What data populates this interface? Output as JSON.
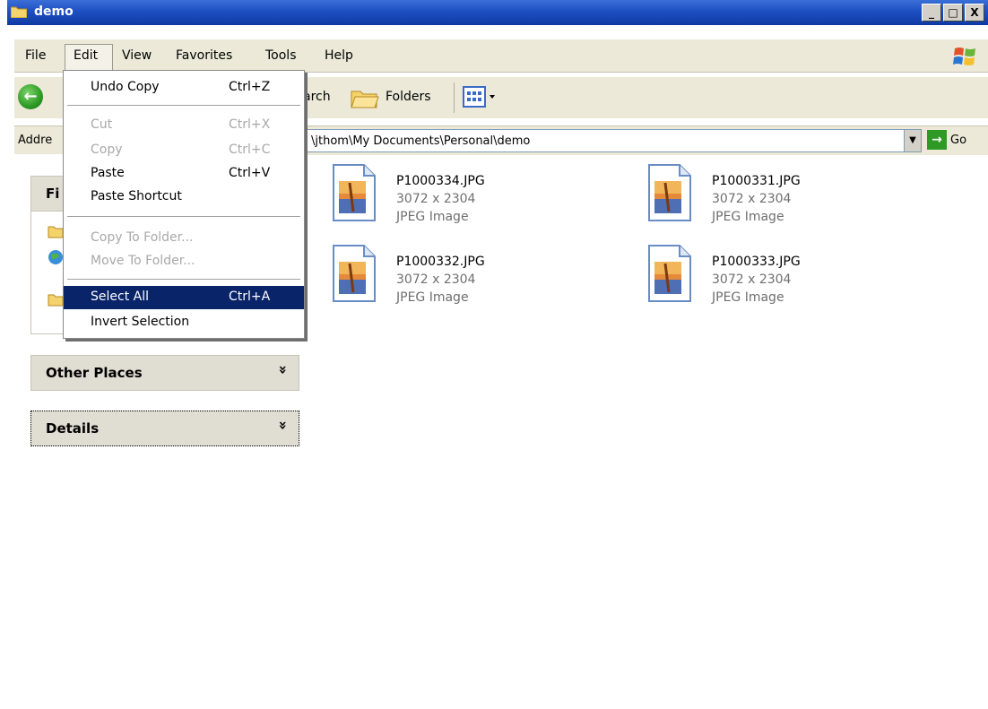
{
  "window": {
    "title": "demo"
  },
  "window_controls": [
    "_",
    "□",
    "X"
  ],
  "menubar": {
    "items": [
      "File",
      "Edit",
      "View",
      "Favorites",
      "Tools",
      "Help"
    ]
  },
  "toolbar": {
    "search_partial": "arch",
    "folders": "Folders"
  },
  "address": {
    "label": "Addre",
    "path": "\\jthom\\My Documents\\Personal\\demo",
    "go_label": "Go"
  },
  "edit_menu": {
    "items": [
      {
        "label": "Undo Copy",
        "shortcut": "Ctrl+Z",
        "enabled": true,
        "selected": false
      },
      {
        "label": "Cut",
        "shortcut": "Ctrl+X",
        "enabled": false,
        "selected": false
      },
      {
        "label": "Copy",
        "shortcut": "Ctrl+C",
        "enabled": false,
        "selected": false
      },
      {
        "label": "Paste",
        "shortcut": "Ctrl+V",
        "enabled": true,
        "selected": false
      },
      {
        "label": "Paste Shortcut",
        "shortcut": "",
        "enabled": true,
        "selected": false
      },
      {
        "label": "Copy To Folder...",
        "shortcut": "",
        "enabled": false,
        "selected": false
      },
      {
        "label": "Move To Folder...",
        "shortcut": "",
        "enabled": false,
        "selected": false
      },
      {
        "label": "Select All",
        "shortcut": "Ctrl+A",
        "enabled": true,
        "selected": true
      },
      {
        "label": "Invert Selection",
        "shortcut": "",
        "enabled": true,
        "selected": false
      }
    ]
  },
  "left_pane": {
    "tasks_header_partial": "Fi",
    "other_places": "Other Places",
    "details": "Details",
    "chevron": "»"
  },
  "files": [
    {
      "name": "P1000334.JPG",
      "dims": "3072 x 2304",
      "type": "JPEG Image"
    },
    {
      "name": "P1000331.JPG",
      "dims": "3072 x 2304",
      "type": "JPEG Image"
    },
    {
      "name": "P1000332.JPG",
      "dims": "3072 x 2304",
      "type": "JPEG Image"
    },
    {
      "name": "P1000333.JPG",
      "dims": "3072 x 2304",
      "type": "JPEG Image"
    }
  ],
  "colors": {
    "titlebar": "#1e4fc2",
    "chrome": "#ece9d8",
    "selection": "#0a246a",
    "disabled_text": "#a8a8a8"
  }
}
